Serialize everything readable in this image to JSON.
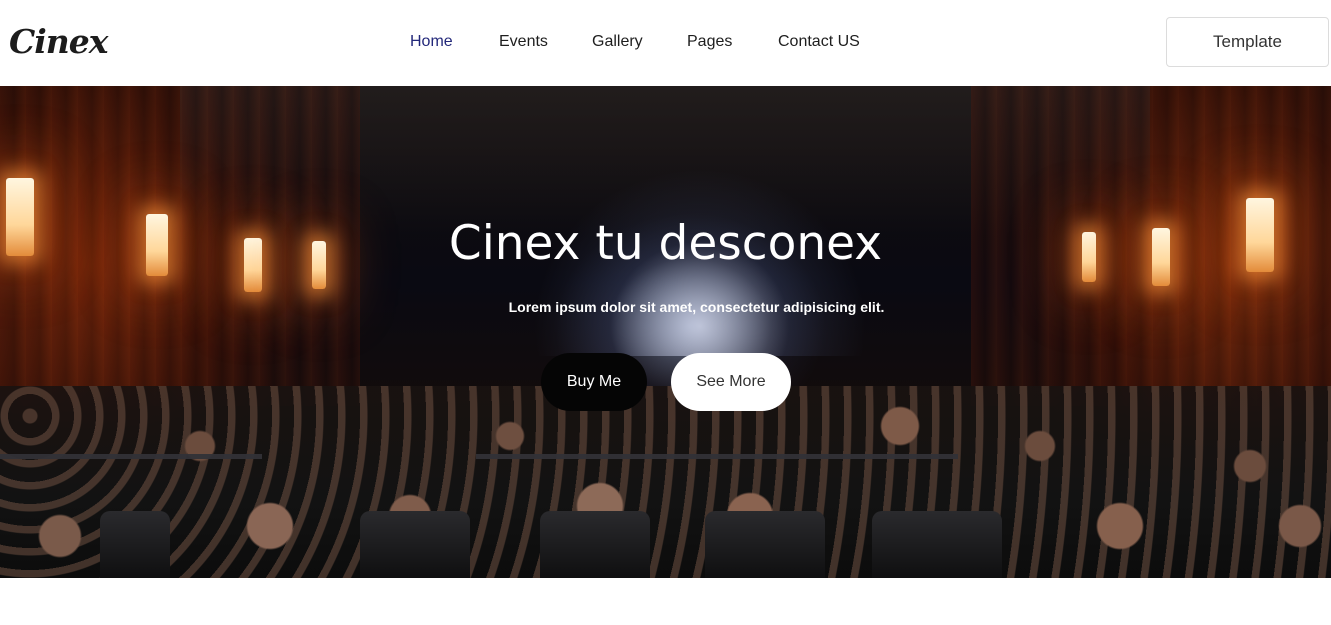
{
  "header": {
    "logo": "Cinex",
    "nav": [
      {
        "label": "Home",
        "active": true
      },
      {
        "label": "Events",
        "active": false
      },
      {
        "label": "Gallery",
        "active": false
      },
      {
        "label": "Pages",
        "active": false
      },
      {
        "label": "Contact US",
        "active": false
      }
    ],
    "template_button": "Template"
  },
  "hero": {
    "title": "Cinex tu desconex",
    "subtitle": "Lorem ipsum dolor sit amet, consectetur adipisicing elit.",
    "buy_button": "Buy Me",
    "more_button": "See More"
  },
  "colors": {
    "active_nav": "#23287a",
    "buy_button_bg": "#050505",
    "more_button_bg": "#ffffff"
  }
}
